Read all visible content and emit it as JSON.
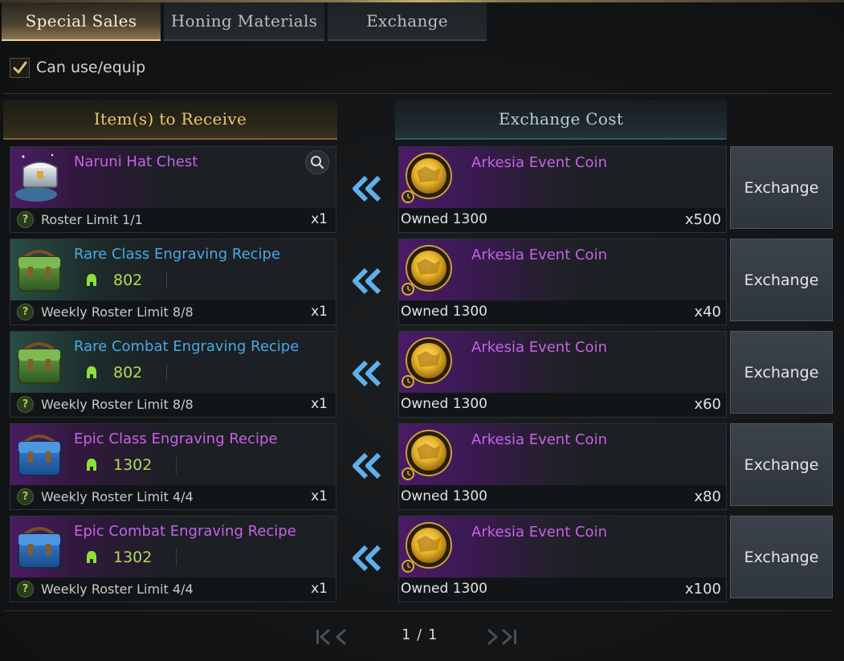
{
  "tabs": [
    {
      "label": "Special Sales",
      "active": true
    },
    {
      "label": "Honing Materials",
      "active": false
    },
    {
      "label": "Exchange",
      "active": false
    }
  ],
  "filter": {
    "label": "Can use/equip",
    "checked": true
  },
  "headers": {
    "receive": "Item(s) to Receive",
    "cost": "Exchange Cost"
  },
  "rows": [
    {
      "item": {
        "name": "Naruni Hat Chest",
        "rarity": "purple",
        "icon": "chest-icon",
        "limit": "Roster Limit 1/1",
        "qty": "x1"
      },
      "cost": {
        "name": "Arkesia Event Coin",
        "icon": "event-coin-icon",
        "owned": "Owned 1300",
        "qty": "x500"
      },
      "button": "Exchange"
    },
    {
      "item": {
        "name": "Rare Class Engraving Recipe",
        "rarity": "blue",
        "icon": "green-bag-icon",
        "stat": "802",
        "limit": "Weekly Roster Limit 8/8",
        "qty": "x1"
      },
      "cost": {
        "name": "Arkesia Event Coin",
        "icon": "event-coin-icon",
        "owned": "Owned 1300",
        "qty": "x40"
      },
      "button": "Exchange"
    },
    {
      "item": {
        "name": "Rare Combat Engraving Recipe",
        "rarity": "blue",
        "icon": "green-bag-icon",
        "stat": "802",
        "limit": "Weekly Roster Limit 8/8",
        "qty": "x1"
      },
      "cost": {
        "name": "Arkesia Event Coin",
        "icon": "event-coin-icon",
        "owned": "Owned 1300",
        "qty": "x60"
      },
      "button": "Exchange"
    },
    {
      "item": {
        "name": "Epic Class Engraving Recipe",
        "rarity": "purple",
        "icon": "blue-bag-icon",
        "stat": "1302",
        "limit": "Weekly Roster Limit 4/4",
        "qty": "x1"
      },
      "cost": {
        "name": "Arkesia Event Coin",
        "icon": "event-coin-icon",
        "owned": "Owned 1300",
        "qty": "x80"
      },
      "button": "Exchange"
    },
    {
      "item": {
        "name": "Epic Combat Engraving Recipe",
        "rarity": "purple",
        "icon": "blue-bag-icon",
        "stat": "1302",
        "limit": "Weekly Roster Limit 4/4",
        "qty": "x1"
      },
      "cost": {
        "name": "Arkesia Event Coin",
        "icon": "event-coin-icon",
        "owned": "Owned 1300",
        "qty": "x100"
      },
      "button": "Exchange"
    }
  ],
  "pagination": {
    "text": "1 / 1"
  },
  "colors": {
    "gold": "#e9c76a",
    "epic_purple": "#c562e6",
    "rare_blue": "#49a8e6",
    "stat_green": "#b5da58",
    "arrow_blue": "#5fb0ea"
  }
}
